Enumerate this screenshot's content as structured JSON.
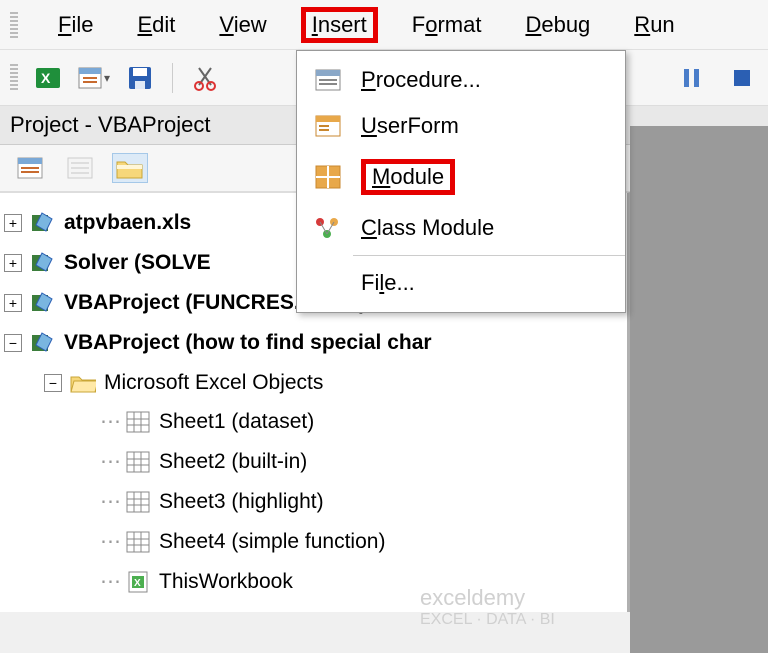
{
  "menubar": {
    "items": [
      {
        "label": "File",
        "accel": "F"
      },
      {
        "label": "Edit",
        "accel": "E"
      },
      {
        "label": "View",
        "accel": "V"
      },
      {
        "label": "Insert",
        "accel": "I"
      },
      {
        "label": "Format",
        "accel": "o"
      },
      {
        "label": "Debug",
        "accel": "D"
      },
      {
        "label": "Run",
        "accel": "R"
      }
    ]
  },
  "insert_menu": {
    "procedure": "Procedure...",
    "userform": "UserForm",
    "module": "Module",
    "class_module": "Class Module",
    "file": "File..."
  },
  "panel": {
    "title": "Project - VBAProject"
  },
  "tree": {
    "items": [
      {
        "label": "atpvbaen.xls",
        "bold": true,
        "expander": "+"
      },
      {
        "label": "Solver (SOLVE",
        "bold": true,
        "expander": "+"
      },
      {
        "label": "VBAProject (FUNCRES.XLAM)",
        "bold": true,
        "expander": "+"
      },
      {
        "label": "VBAProject (how to find special char",
        "bold": true,
        "expander": "-"
      }
    ],
    "folder": "Microsoft Excel Objects",
    "sheets": [
      "Sheet1 (dataset)",
      "Sheet2 (built-in)",
      "Sheet3 (highlight)",
      "Sheet4 (simple function)",
      "ThisWorkbook"
    ]
  },
  "watermark": {
    "title": "exceldemy",
    "sub": "EXCEL · DATA · BI"
  }
}
